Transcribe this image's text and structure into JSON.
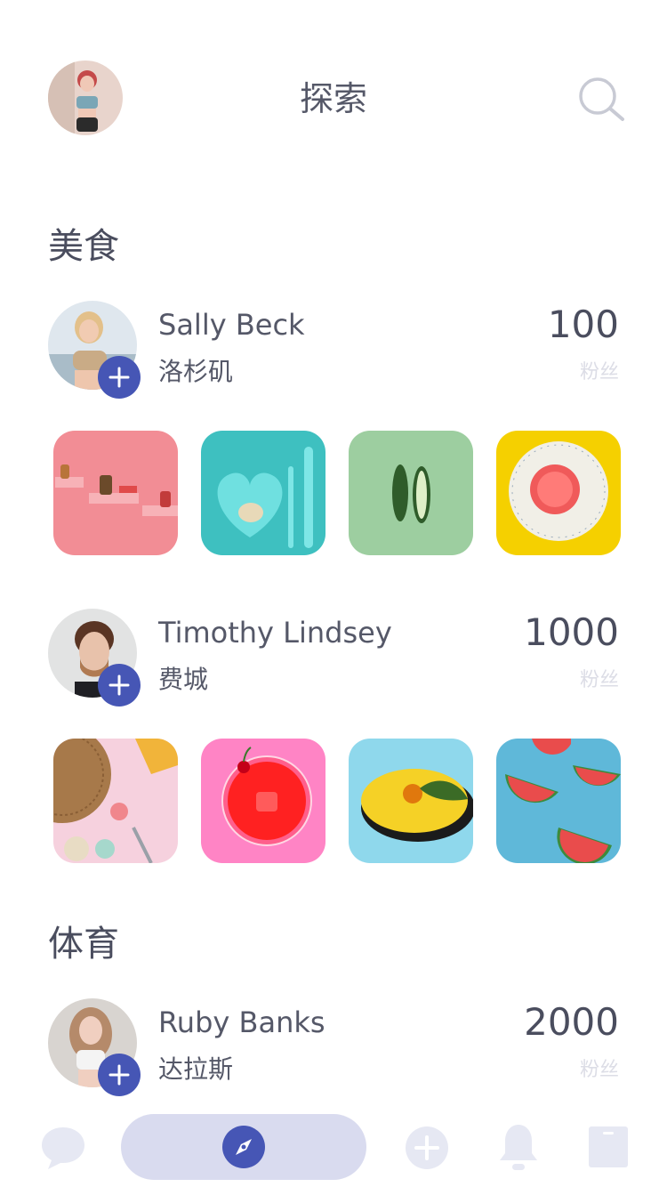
{
  "header": {
    "title": "探索"
  },
  "sections": [
    {
      "title": "美食",
      "users": [
        {
          "name": "Sally Beck",
          "city": "洛杉矶",
          "fans": "100",
          "fans_label": "粉丝"
        },
        {
          "name": "Timothy Lindsey",
          "city": "费城",
          "fans": "1000",
          "fans_label": "粉丝"
        }
      ]
    },
    {
      "title": "体育",
      "users": [
        {
          "name": "Ruby Banks",
          "city": "达拉斯",
          "fans": "2000",
          "fans_label": "粉丝"
        }
      ]
    }
  ],
  "nav": {
    "items": [
      "chat-bubble-icon",
      "compass-icon",
      "plus-circle-icon",
      "bell-icon",
      "bookmark-icon"
    ],
    "active": "compass-icon"
  },
  "colors": {
    "accent": "#4656b5",
    "active_pill": "#d9dbef",
    "inactive_icon": "#e6e8f3",
    "text": "#4a4d5e",
    "muted": "#dcdde6"
  }
}
